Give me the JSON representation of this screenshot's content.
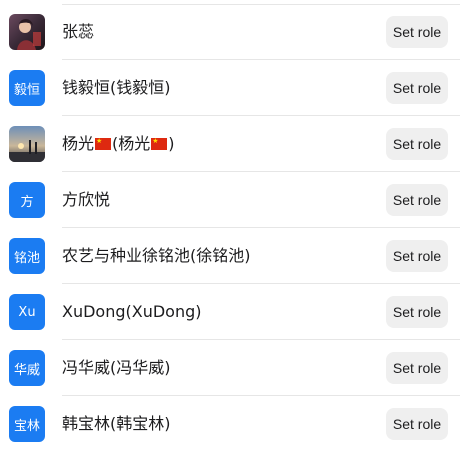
{
  "members": [
    {
      "name": "张蕊",
      "avatar_type": "photo",
      "avatar_text": "",
      "action_label": "Set role"
    },
    {
      "name": "钱毅恒(钱毅恒)",
      "avatar_type": "text",
      "avatar_text": "毅恒",
      "action_label": "Set role"
    },
    {
      "name_parts": [
        "杨光",
        "(杨光",
        ")"
      ],
      "avatar_type": "photo",
      "avatar_text": "",
      "action_label": "Set role",
      "flag": "cn-flag-icon"
    },
    {
      "name": "方欣悦",
      "avatar_type": "text",
      "avatar_text": "方",
      "action_label": "Set role"
    },
    {
      "name": "农艺与种业徐铭池(徐铭池)",
      "avatar_type": "text",
      "avatar_text": "铭池",
      "action_label": "Set role"
    },
    {
      "name": "XuDong(XuDong)",
      "avatar_type": "text",
      "avatar_text": "Xu",
      "action_label": "Set role"
    },
    {
      "name": "冯华威(冯华威)",
      "avatar_type": "text",
      "avatar_text": "华威",
      "action_label": "Set role"
    },
    {
      "name": "韩宝林(韩宝林)",
      "avatar_type": "text",
      "avatar_text": "宝林",
      "action_label": "Set role"
    }
  ],
  "colors": {
    "avatar_blue": "#1b7cf2",
    "button_bg": "#efefef",
    "divider": "#e6e6e6"
  }
}
